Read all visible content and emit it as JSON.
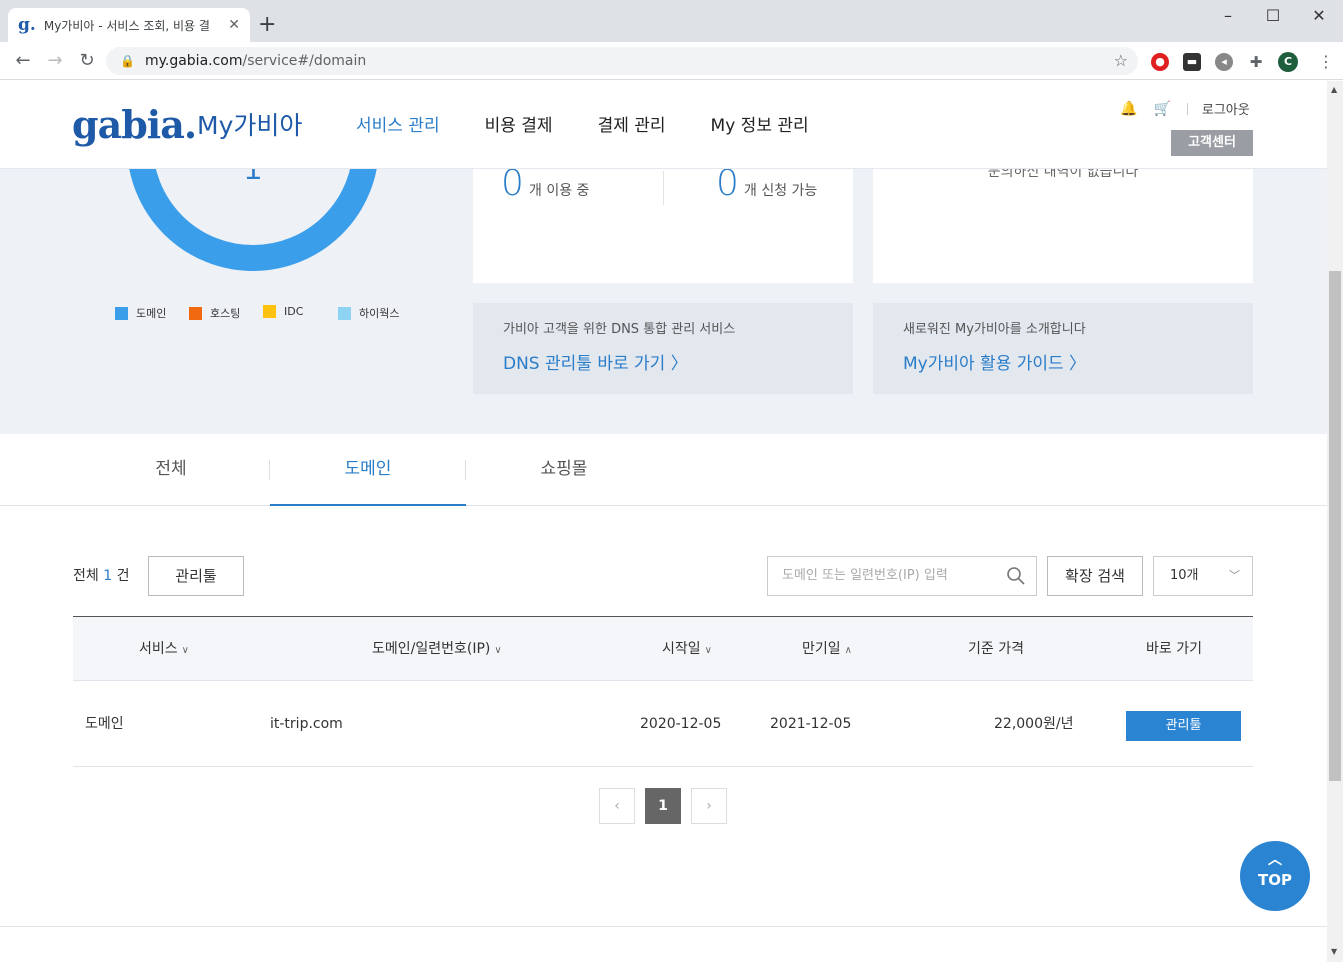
{
  "browser": {
    "tab_title": "My가비아 - 서비스 조회, 비용 결",
    "favicon": "g.",
    "url_host": "my.gabia.com",
    "url_path": "/service#/domain",
    "profile_initial": "C"
  },
  "header": {
    "logo": "gabia.",
    "logo_sub": "My가비아",
    "nav": [
      "서비스 관리",
      "비용 결제",
      "결제 관리",
      "My 정보 관리"
    ],
    "logout": "로그아웃",
    "customer_center": "고객센터"
  },
  "summary": {
    "donut_center": "1",
    "legend": [
      "도메인",
      "호스팅",
      "IDC",
      "하이웍스"
    ],
    "legend_colors": [
      "#3b9eea",
      "#f26a0f",
      "#ffc20e",
      "#8fd3f4"
    ],
    "in_use_count": "0",
    "in_use_label": "개 이용 중",
    "available_count": "0",
    "available_label": "개 신청 가능",
    "notice_text": "문의하신 내역이 없습니다",
    "dns_desc": "가비아 고객을 위한 DNS 통합 관리 서비스",
    "dns_link": "DNS 관리툴 바로 가기 〉",
    "guide_desc": "새로워진 My가비아를 소개합니다",
    "guide_link": "My가비아 활용 가이드 〉"
  },
  "tabs": [
    "전체",
    "도메인",
    "쇼핑몰"
  ],
  "list": {
    "total_prefix": "전체",
    "total_count": "1",
    "total_suffix": "건",
    "manage_tool": "관리툴",
    "search_placeholder": "도메인 또는 일련번호(IP) 입력",
    "advanced_search": "확장 검색",
    "page_size": "10개"
  },
  "table": {
    "headers": [
      "서비스",
      "도메인/일련번호(IP)",
      "시작일",
      "만기일",
      "기준 가격",
      "바로 가기"
    ],
    "rows": [
      {
        "service": "도메인",
        "domain": "it-trip.com",
        "start": "2020-12-05",
        "end": "2021-12-05",
        "price": "22,000원/년",
        "action": "관리툴"
      }
    ]
  },
  "pagination": {
    "prev": "‹",
    "current": "1",
    "next": "›"
  },
  "top_button": "TOP"
}
